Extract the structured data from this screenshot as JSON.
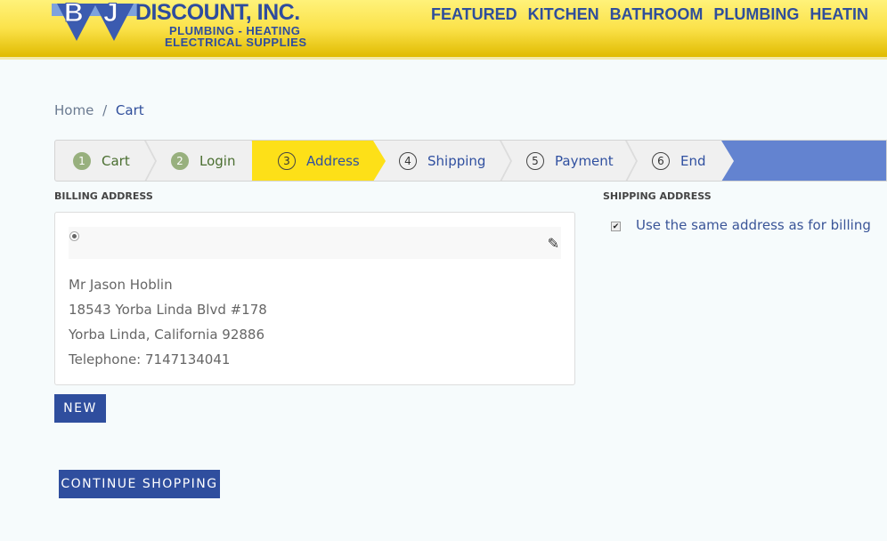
{
  "header": {
    "logo_text": {
      "letters": [
        "B",
        "J"
      ],
      "name": "DISCOUNT, INC.",
      "line1": "PLUMBING - HEATING",
      "line2": "ELECTRICAL SUPPLIES"
    },
    "nav": [
      "FEATURED",
      "KITCHEN",
      "BATHROOM",
      "PLUMBING",
      "HEATIN"
    ]
  },
  "breadcrumb": {
    "home": "Home",
    "sep": "/",
    "current": "Cart"
  },
  "steps": [
    {
      "num": "1",
      "label": "Cart",
      "state": "done"
    },
    {
      "num": "2",
      "label": "Login",
      "state": "done"
    },
    {
      "num": "3",
      "label": "Address",
      "state": "active"
    },
    {
      "num": "4",
      "label": "Shipping",
      "state": "pending"
    },
    {
      "num": "5",
      "label": "Payment",
      "state": "pending"
    },
    {
      "num": "6",
      "label": "End",
      "state": "pending"
    }
  ],
  "billing": {
    "title": "BILLING ADDRESS",
    "name": "Mr Jason Hoblin",
    "street": "18543 Yorba Linda Blvd #178",
    "city": "Yorba Linda, California 92886",
    "phone": "Telephone: 7147134041",
    "selected": true
  },
  "shipping": {
    "title": "SHIPPING ADDRESS",
    "same_label": "Use the same address as for billing",
    "same_checked": true
  },
  "buttons": {
    "new": "NEW",
    "continue": "CONTINUE SHOPPING"
  },
  "colors": {
    "header": "#fbe24a",
    "brand_blue": "#2f4e9e",
    "active_step": "#fde018",
    "done_step": "#98b07e"
  }
}
